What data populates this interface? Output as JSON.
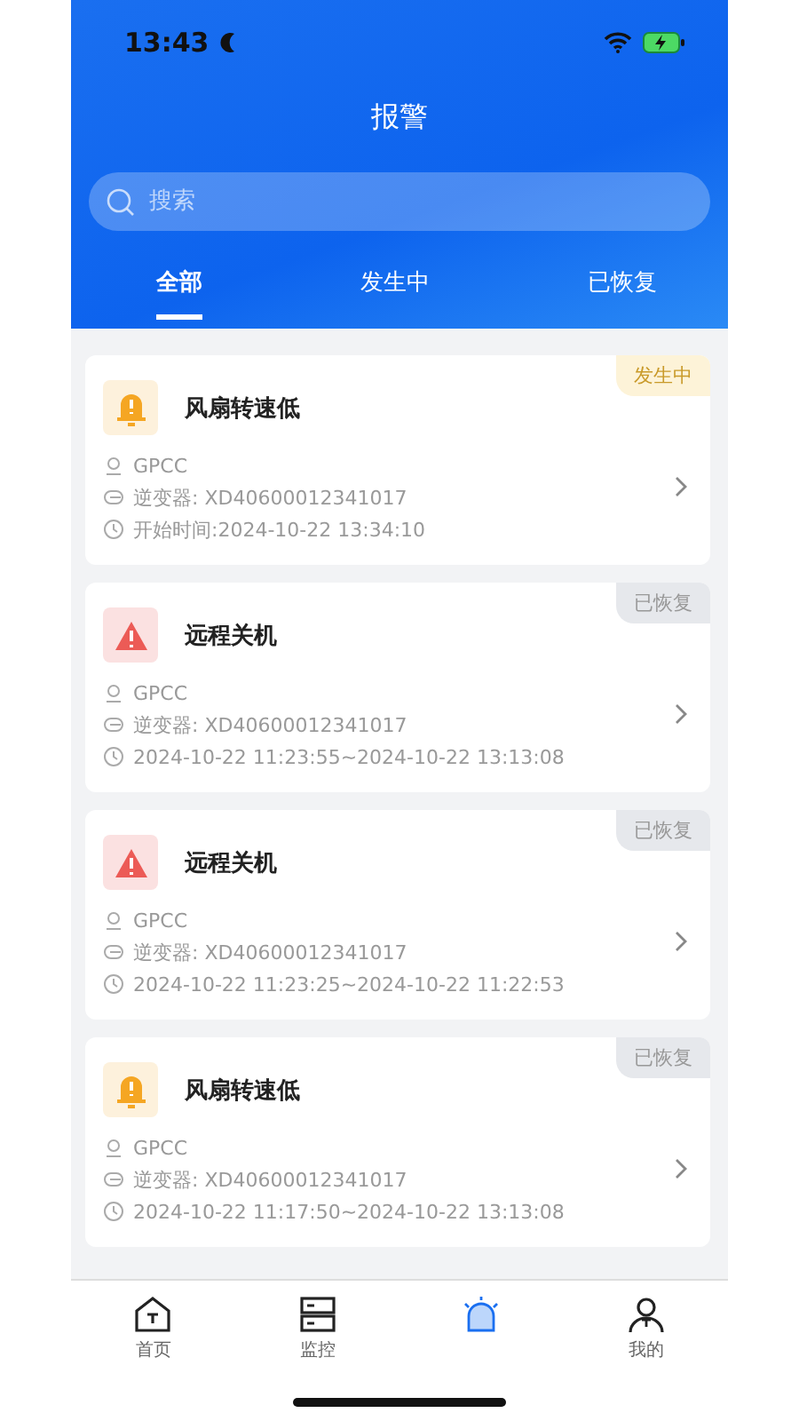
{
  "status_bar": {
    "time": "13:43"
  },
  "header": {
    "title": "报警"
  },
  "search": {
    "placeholder": "搜索"
  },
  "tabs": [
    {
      "label": "全部",
      "selected": true
    },
    {
      "label": "发生中",
      "selected": false
    },
    {
      "label": "已恢复",
      "selected": false
    }
  ],
  "alarms": [
    {
      "kind": "warning",
      "title": "风扇转速低",
      "status": "发生中",
      "active": true,
      "site": "GPCC",
      "inverter": "逆变器: XD40600012341017",
      "time": "开始时间:2024-10-22 13:34:10"
    },
    {
      "kind": "fault",
      "title": "远程关机",
      "status": "已恢复",
      "active": false,
      "site": "GPCC",
      "inverter": "逆变器: XD40600012341017",
      "time": "2024-10-22 11:23:55~2024-10-22 13:13:08"
    },
    {
      "kind": "fault",
      "title": "远程关机",
      "status": "已恢复",
      "active": false,
      "site": "GPCC",
      "inverter": "逆变器: XD40600012341017",
      "time": "2024-10-22 11:23:25~2024-10-22 11:22:53"
    },
    {
      "kind": "warning",
      "title": "风扇转速低",
      "status": "已恢复",
      "active": false,
      "site": "GPCC",
      "inverter": "逆变器: XD40600012341017",
      "time": "2024-10-22 11:17:50~2024-10-22 13:13:08"
    }
  ],
  "nav": [
    {
      "kind": "home",
      "label": "首页",
      "selected": false
    },
    {
      "kind": "monitor",
      "label": "监控",
      "selected": false
    },
    {
      "kind": "alarm",
      "selected": true
    },
    {
      "kind": "user",
      "label": "我的",
      "selected": false
    }
  ]
}
